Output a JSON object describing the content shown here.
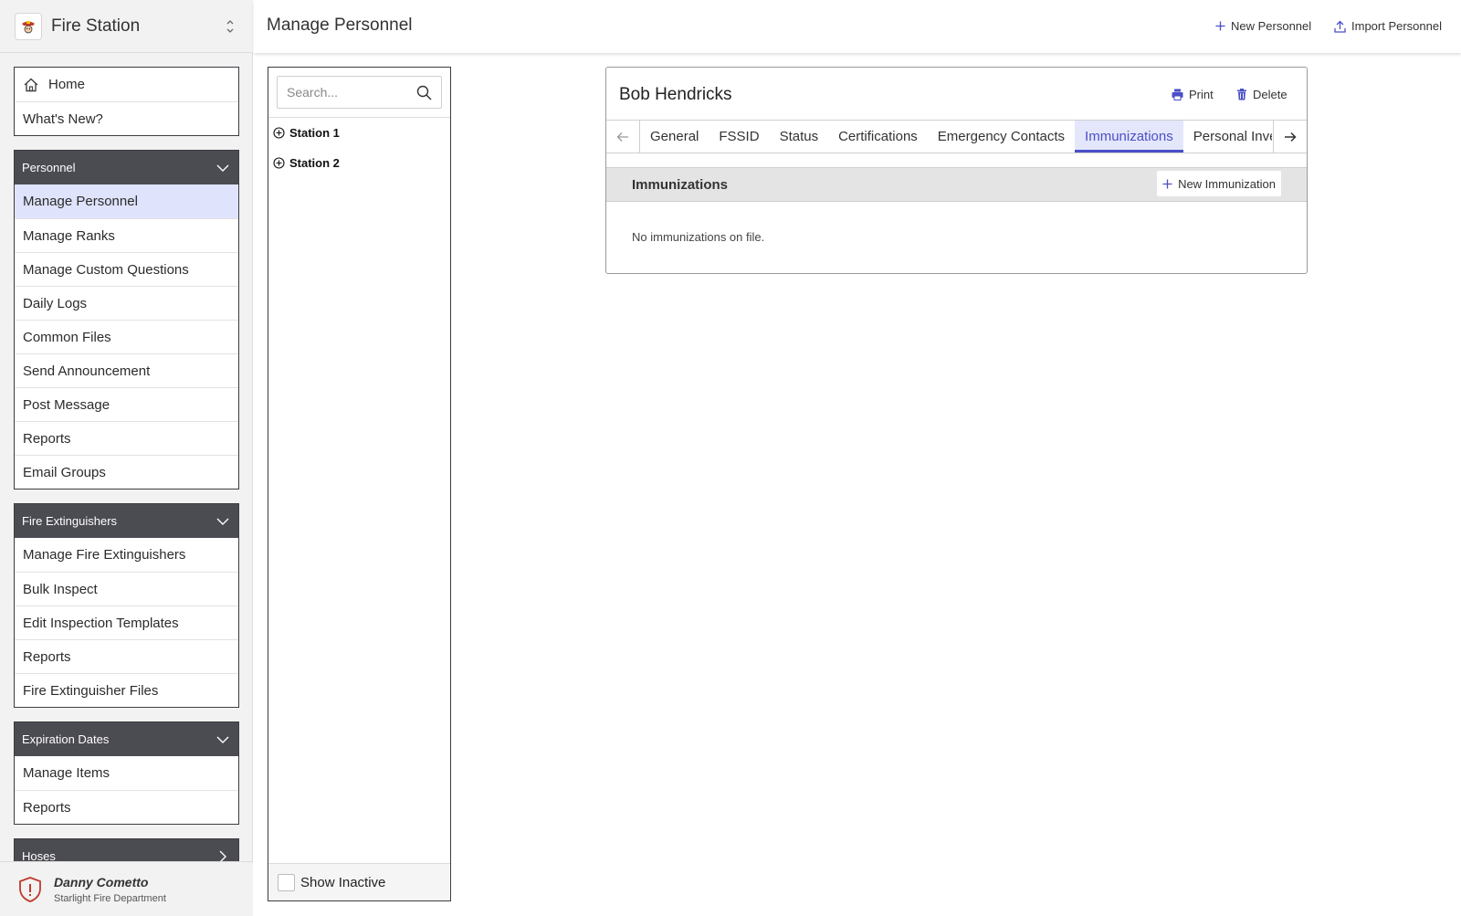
{
  "app": {
    "title": "Fire Station"
  },
  "sidebar": {
    "top_items": [
      {
        "label": "Home",
        "icon": "home-icon"
      },
      {
        "label": "What's New?"
      }
    ],
    "sections": [
      {
        "title": "Personnel",
        "items": [
          "Manage Personnel",
          "Manage Ranks",
          "Manage Custom Questions",
          "Daily Logs",
          "Common Files",
          "Send Announcement",
          "Post Message",
          "Reports",
          "Email Groups"
        ],
        "active": "Manage Personnel"
      },
      {
        "title": "Fire Extinguishers",
        "items": [
          "Manage Fire Extinguishers",
          "Bulk Inspect",
          "Edit Inspection Templates",
          "Reports",
          "Fire Extinguisher Files"
        ]
      },
      {
        "title": "Expiration Dates",
        "items": [
          "Manage Items",
          "Reports"
        ]
      },
      {
        "title": "Hoses",
        "items": []
      }
    ]
  },
  "user": {
    "name": "Danny Cometto",
    "org": "Starlight Fire Department"
  },
  "header": {
    "title": "Manage Personnel",
    "new_personnel": "New Personnel",
    "import_personnel": "Import Personnel"
  },
  "tree": {
    "search_placeholder": "Search...",
    "nodes": [
      "Station 1",
      "Station 2"
    ],
    "show_inactive": "Show Inactive"
  },
  "detail": {
    "name": "Bob Hendricks",
    "print": "Print",
    "delete": "Delete",
    "tabs": [
      "General",
      "FSSID",
      "Status",
      "Certifications",
      "Emergency Contacts",
      "Immunizations",
      "Personal Inventory"
    ],
    "active_tab": "Immunizations",
    "section_title": "Immunizations",
    "new_immunization": "New Immunization",
    "empty_message": "No immunizations on file."
  },
  "colors": {
    "accent": "#4a4fc6",
    "sidebar_header": "#4b4b52",
    "active_item": "#dfe3fb"
  }
}
